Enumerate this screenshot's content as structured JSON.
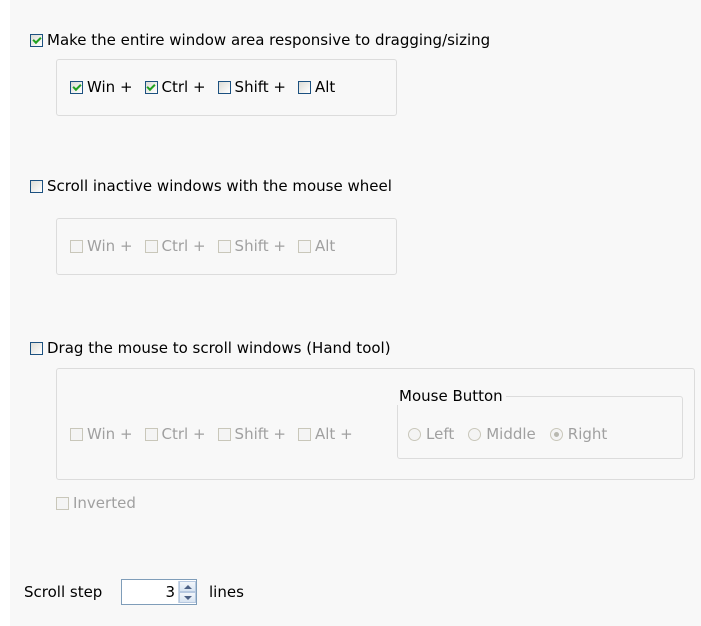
{
  "section_drag": {
    "label": "Make the entire window area responsive to dragging/sizing",
    "checked": true,
    "modifiers": [
      {
        "label": "Win +",
        "checked": true
      },
      {
        "label": "Ctrl +",
        "checked": true
      },
      {
        "label": "Shift +",
        "checked": false
      },
      {
        "label": "Alt",
        "checked": false
      }
    ]
  },
  "section_scroll_inactive": {
    "label": "Scroll inactive windows with the mouse wheel",
    "checked": false,
    "modifiers": [
      {
        "label": "Win +",
        "checked": false
      },
      {
        "label": "Ctrl +",
        "checked": false
      },
      {
        "label": "Shift +",
        "checked": false
      },
      {
        "label": "Alt",
        "checked": false
      }
    ]
  },
  "section_hand_tool": {
    "label": "Drag the mouse to scroll windows (Hand tool)",
    "checked": false,
    "modifiers": [
      {
        "label": "Win +",
        "checked": false
      },
      {
        "label": "Ctrl +",
        "checked": false
      },
      {
        "label": "Shift +",
        "checked": false
      },
      {
        "label": "Alt +",
        "checked": false
      }
    ],
    "mouse_button": {
      "title": "Mouse Button",
      "options": [
        "Left",
        "Middle",
        "Right"
      ],
      "selected": "Right"
    },
    "inverted": {
      "label": "Inverted",
      "checked": false
    }
  },
  "scroll_step": {
    "label": "Scroll step",
    "value": "3",
    "unit": "lines"
  }
}
